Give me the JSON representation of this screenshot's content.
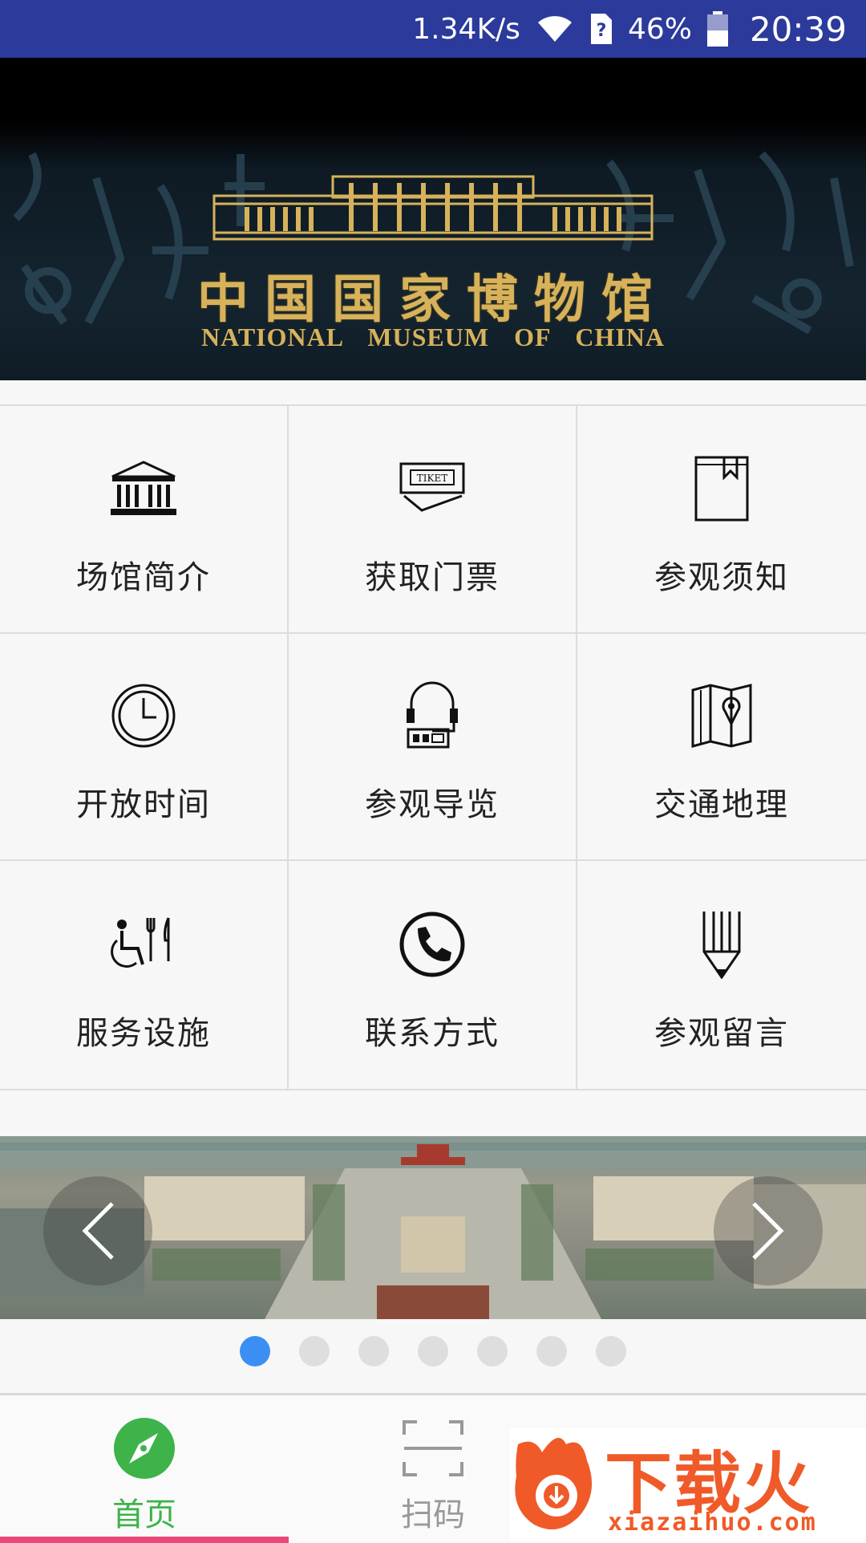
{
  "status_bar": {
    "speed": "1.34K/s",
    "battery": "46%",
    "time": "20:39"
  },
  "banner": {
    "title_cn": "中国国家博物馆",
    "title_en": "NATIONAL MUSEUM OF CHINA"
  },
  "menu": [
    {
      "label": "场馆简介",
      "icon": "museum-building-icon"
    },
    {
      "label": "获取门票",
      "icon": "ticket-icon",
      "icon_text": "TIKET"
    },
    {
      "label": "参观须知",
      "icon": "notebook-icon"
    },
    {
      "label": "开放时间",
      "icon": "clock-icon"
    },
    {
      "label": "参观导览",
      "icon": "audio-guide-icon"
    },
    {
      "label": "交通地理",
      "icon": "map-pin-icon"
    },
    {
      "label": "服务设施",
      "icon": "accessibility-dining-icon"
    },
    {
      "label": "联系方式",
      "icon": "phone-icon"
    },
    {
      "label": "参观留言",
      "icon": "pencil-icon"
    }
  ],
  "carousel": {
    "current": 1,
    "count": 7
  },
  "bottom_nav": [
    {
      "label": "首页",
      "icon": "compass-icon",
      "active": true
    },
    {
      "label": "扫码",
      "icon": "scan-icon",
      "active": false
    },
    {
      "label": "",
      "icon": "search-icon",
      "active": false
    }
  ],
  "watermark": {
    "text": "下载火",
    "url": "xiazaihuo.com"
  },
  "colors": {
    "status_bar": "#2b3a9b",
    "accent_green": "#3db34a",
    "dot_active": "#3b8ff2",
    "tab_indicator": "#e8487a",
    "gold": "#d7b25a"
  }
}
